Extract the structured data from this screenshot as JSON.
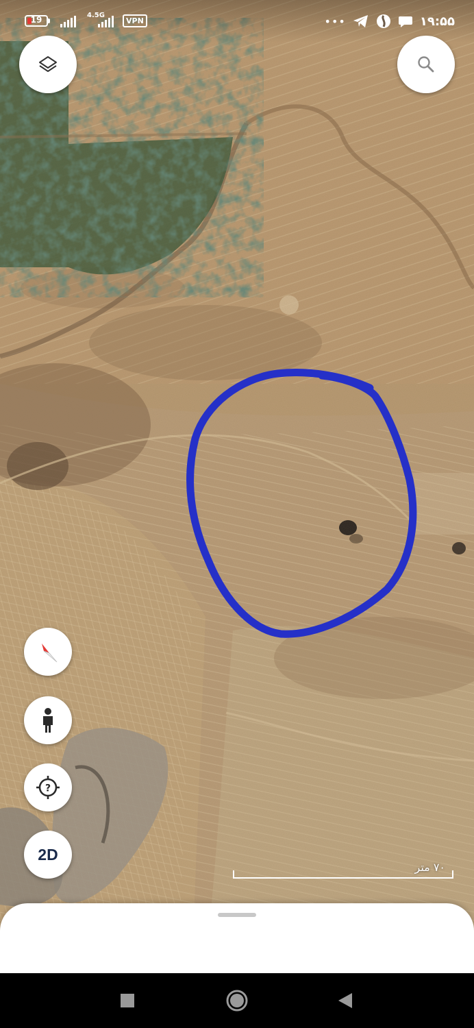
{
  "status_bar": {
    "battery": "19",
    "network_type": "4.5G",
    "vpn_label": "VPN",
    "overflow": "•••",
    "time": "۱۹:۵۵"
  },
  "map": {
    "type": "satellite",
    "scale_label": "۷۰ متر",
    "annotation_color": "#2530c8"
  },
  "controls": {
    "layers_icon": "layers-icon",
    "search_icon": "search-icon",
    "compass_icon": "compass-icon",
    "street_view_icon": "pegman-icon",
    "help_icon": "help-target-icon",
    "view_mode_label": "2D"
  },
  "nav_bar": {
    "recents_icon": "square-icon",
    "home_icon": "circle-icon",
    "back_icon": "triangle-back-icon"
  }
}
